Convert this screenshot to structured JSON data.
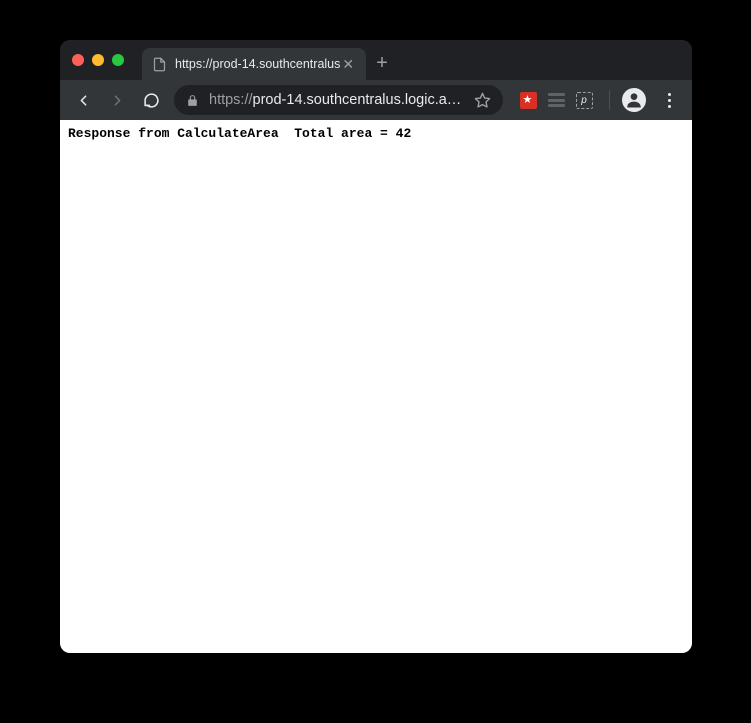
{
  "tab": {
    "title": "https://prod-14.southcentralus"
  },
  "address_bar": {
    "protocol": "https://",
    "display_url": "prod-14.southcentralus.logic.az..."
  },
  "extensions": {
    "pocket_label": "p"
  },
  "page": {
    "body_text": "Response from CalculateArea  Total area = 42"
  }
}
